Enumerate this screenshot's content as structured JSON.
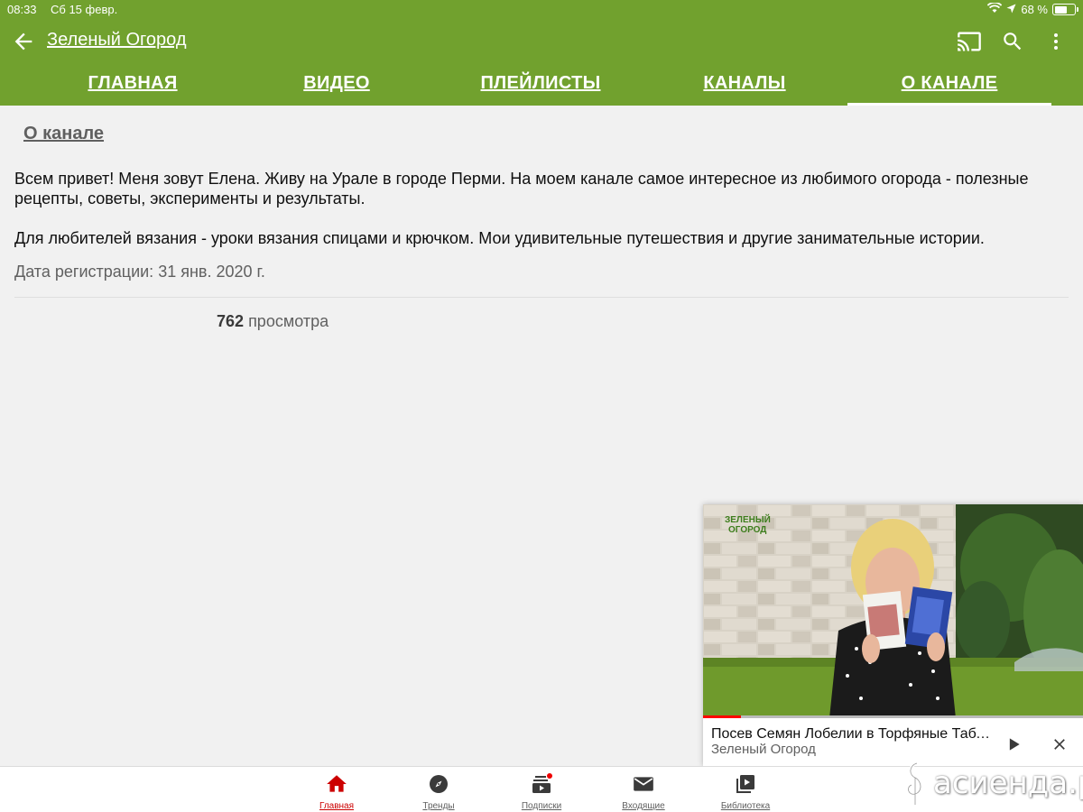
{
  "status_bar": {
    "time": "08:33",
    "date": "Сб 15 февр.",
    "battery_text": "68 %",
    "battery_level": 0.68
  },
  "app_bar": {
    "channel_title": "Зеленый Огород",
    "icons": [
      "back-arrow-icon",
      "cast-icon",
      "search-icon",
      "more-vert-icon"
    ],
    "background_color": "#71a12e"
  },
  "tabs": [
    {
      "label": "ГЛАВНАЯ",
      "active": false
    },
    {
      "label": "ВИДЕО",
      "active": false
    },
    {
      "label": "ПЛЕЙЛИСТЫ",
      "active": false
    },
    {
      "label": "КАНАЛЫ",
      "active": false
    },
    {
      "label": "О КАНАЛЕ",
      "active": true
    }
  ],
  "about": {
    "section_title": "О канале",
    "paragraph_1": "Всем привет! Меня зовут Елена. Живу на Урале в городе Перми. На моем канале самое интересное из любимого огорода - полезные рецепты, советы, эксперименты и результаты.",
    "paragraph_2": "Для любителей вязания - уроки вязания спицами и крючком. Мои удивительные путешествия и другие занимательные истории.",
    "registration": "Дата регистрации: 31 янв. 2020 г.",
    "views_count": "762",
    "views_label": "просмотра"
  },
  "mini_player": {
    "thumb_logo_line1": "ЗЕЛЕНЫЙ",
    "thumb_logo_line2": "ОГОРОД",
    "title": "Посев Семян Лобелии в Торфяные Таблетки",
    "channel": "Зеленый Огород",
    "progress": 0.1,
    "icons": [
      "play-icon",
      "close-icon"
    ]
  },
  "bottom_nav": [
    {
      "label": "Главная",
      "icon": "home-icon",
      "active": true
    },
    {
      "label": "Тренды",
      "icon": "explore-icon",
      "active": false
    },
    {
      "label": "Подписки",
      "icon": "subscriptions-icon",
      "active": false
    },
    {
      "label": "Входящие",
      "icon": "mail-icon",
      "active": false
    },
    {
      "label": "Библиотека",
      "icon": "library-icon",
      "active": false
    }
  ],
  "watermark": {
    "text": "асиенда.ру"
  },
  "colors": {
    "accent_green": "#71a12e",
    "active_red": "#cc0000",
    "progress_red": "#ff0000"
  }
}
